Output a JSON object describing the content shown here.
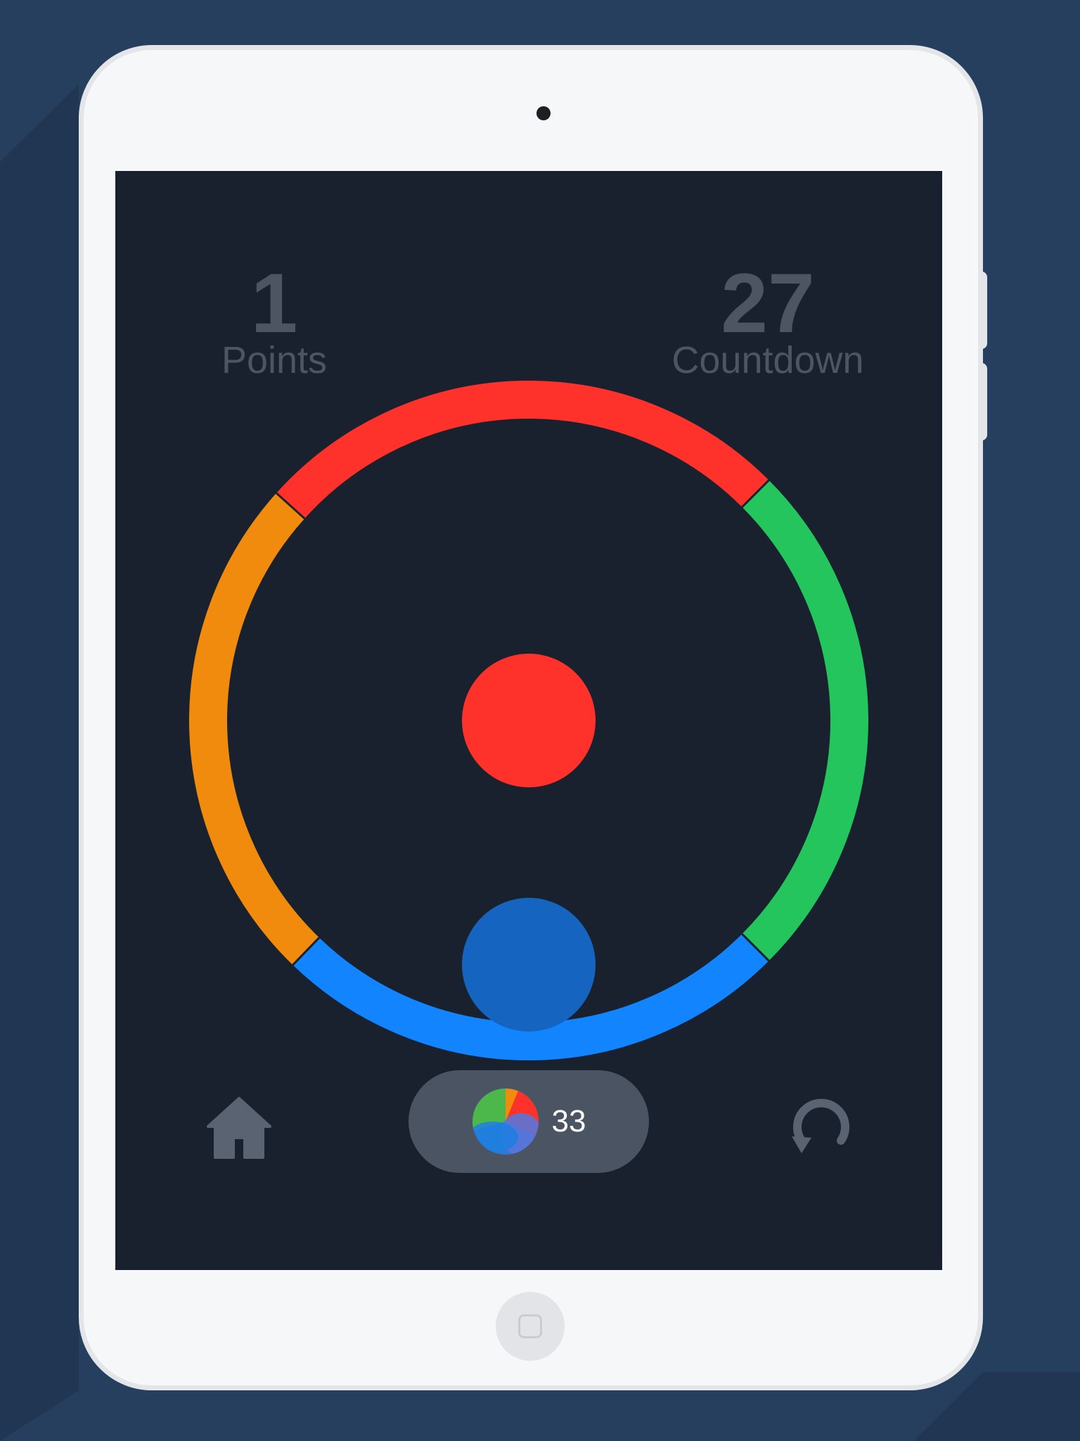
{
  "game": {
    "score_value": "1",
    "score_label": "Points",
    "countdown_value": "27",
    "countdown_label": "Countdown",
    "coins_count": "33"
  },
  "ring": {
    "segments": [
      {
        "name": "red-segment",
        "color": "#ff322b"
      },
      {
        "name": "green-segment",
        "color": "#23c55c"
      },
      {
        "name": "blue-segment",
        "color": "#1284fe"
      },
      {
        "name": "orange-segment",
        "color": "#f08b0d"
      }
    ]
  },
  "balls": {
    "center_color": "#ff322b",
    "player_color": "#1565c0"
  },
  "toolbar": {
    "home_icon": "home-icon",
    "restart_icon": "restart-icon",
    "coins_icon": "color-ball-icon"
  },
  "colors": {
    "background": "#263f5f",
    "screen": "#19212e",
    "stat_text": "#4d5563",
    "pill": "#4a5462",
    "icon": "#5a6372"
  }
}
